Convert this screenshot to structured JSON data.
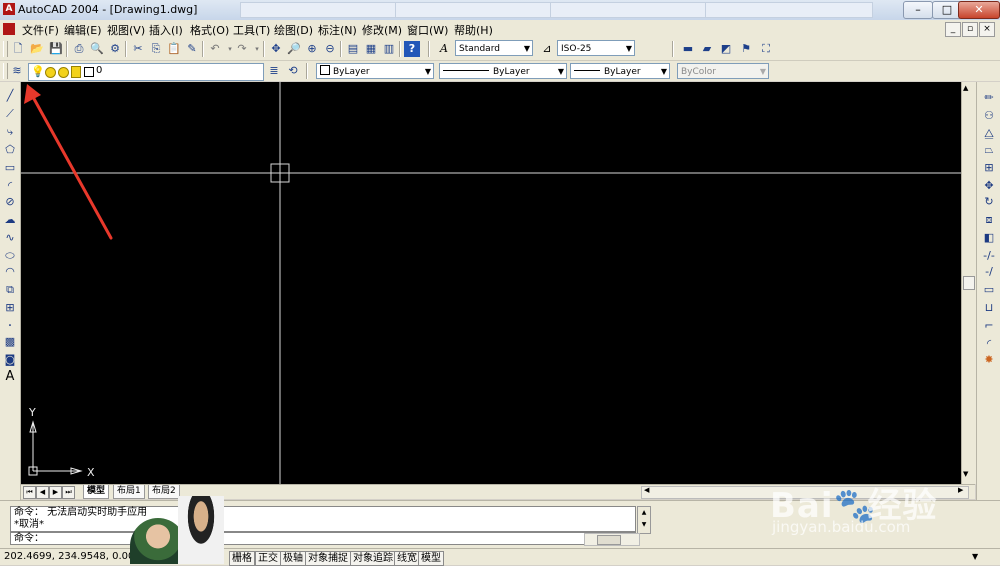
{
  "window": {
    "title": "AutoCAD 2004 - [Drawing1.dwg]",
    "app_icon": "autocad-logo-icon",
    "controls": [
      "minimize",
      "maximize",
      "close"
    ]
  },
  "menu": [
    "文件(F)",
    "编辑(E)",
    "视图(V)",
    "插入(I)",
    "格式(O)",
    "工具(T)",
    "绘图(D)",
    "标注(N)",
    "修改(M)",
    "窗口(W)",
    "帮助(H)"
  ],
  "toolbar": {
    "text_style": "Standard",
    "dim_style": "ISO-25",
    "layer_current": "0",
    "color": "ByLayer",
    "linetype": "ByLayer",
    "lineweight": "ByLayer",
    "plotstyle": "ByColor"
  },
  "canvas": {
    "ucs_x": "X",
    "ucs_y": "Y"
  },
  "layout_tabs": [
    "模型",
    "布局1",
    "布局2"
  ],
  "command": {
    "history_line1": "命令：  无法启动实时助手应用",
    "history_line2": "*取消*",
    "prompt": "命令："
  },
  "status": {
    "coords": "202.4699,  234.9548,  0.0000",
    "buttons": [
      "栅格",
      "正交",
      "极轴",
      "对象捕捉",
      "对象追踪",
      "线宽",
      "模型"
    ]
  },
  "watermark": {
    "brand_text": "Bai",
    "brand_cn": "经验",
    "url": "jingyan.baidu.com"
  },
  "annotation_color": "#e8382b"
}
